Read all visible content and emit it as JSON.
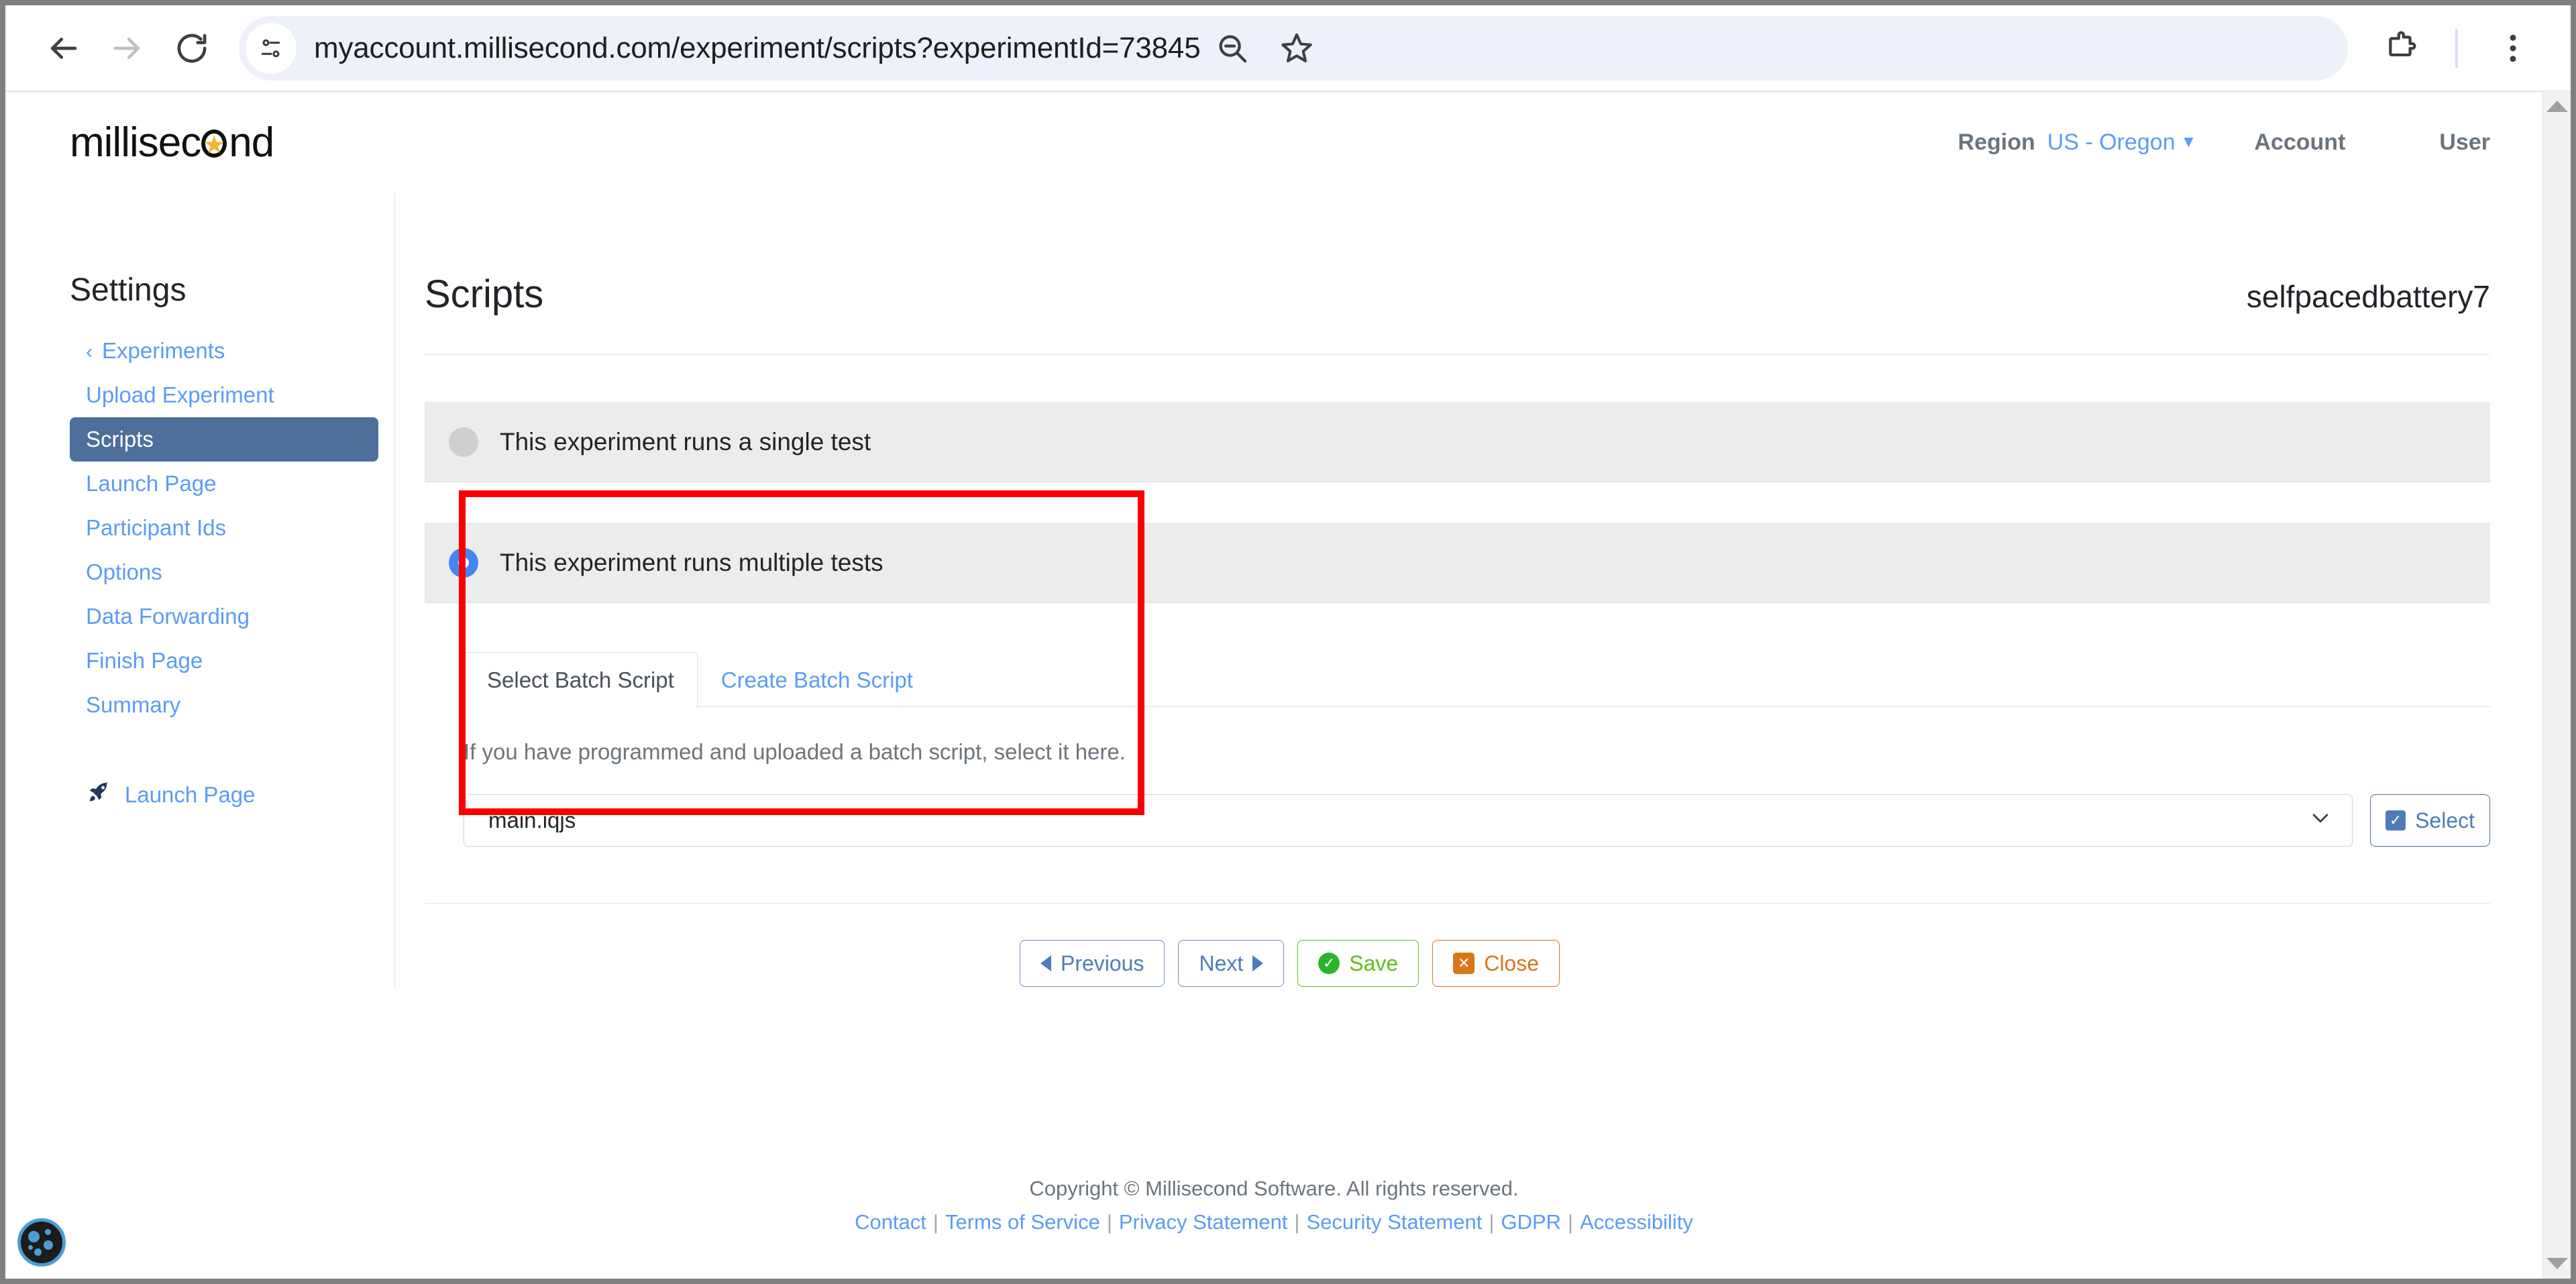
{
  "browser": {
    "url": "myaccount.millisecond.com/experiment/scripts?experimentId=73845",
    "back_label": "Back",
    "forward_label": "Forward",
    "reload_label": "Reload",
    "site_info_label": "View site information",
    "zoom_out_label": "Zoom out",
    "bookmark_label": "Bookmark this tab",
    "extensions_label": "Extensions",
    "menu_label": "Customize and control Chrome"
  },
  "header": {
    "logo_before": "millisec",
    "logo_after": "nd",
    "region_label": "Region",
    "region_value": "US - Oregon",
    "account_label": "Account",
    "user_label": "User"
  },
  "sidebar": {
    "title": "Settings",
    "items": [
      {
        "label": "Experiments",
        "active": false,
        "back": true
      },
      {
        "label": "Upload Experiment",
        "active": false,
        "back": false
      },
      {
        "label": "Scripts",
        "active": true,
        "back": false
      },
      {
        "label": "Launch Page",
        "active": false,
        "back": false
      },
      {
        "label": "Participant Ids",
        "active": false,
        "back": false
      },
      {
        "label": "Options",
        "active": false,
        "back": false
      },
      {
        "label": "Data Forwarding",
        "active": false,
        "back": false
      },
      {
        "label": "Finish Page",
        "active": false,
        "back": false
      },
      {
        "label": "Summary",
        "active": false,
        "back": false
      }
    ],
    "launch_link": "Launch Page"
  },
  "main": {
    "page_title": "Scripts",
    "experiment_name": "selfpacedbattery7",
    "options": [
      {
        "label": "This experiment runs a single test",
        "selected": false
      },
      {
        "label": "This experiment runs multiple tests",
        "selected": true
      }
    ],
    "tabs": [
      {
        "label": "Select Batch Script",
        "active": true
      },
      {
        "label": "Create Batch Script",
        "active": false
      }
    ],
    "hint": "If you have programmed and uploaded a batch script, select it here.",
    "script_value": "main.iqjs",
    "select_button": "Select",
    "actions": [
      {
        "label": "Previous",
        "style": "blue",
        "icon": "triangle-left"
      },
      {
        "label": "Next",
        "style": "blue",
        "icon": "triangle-right"
      },
      {
        "label": "Save",
        "style": "green",
        "icon": "check-circle"
      },
      {
        "label": "Close",
        "style": "orange",
        "icon": "x-square"
      }
    ]
  },
  "footer": {
    "copyright": "Copyright © Millisecond Software. All rights reserved.",
    "links": [
      "Contact",
      "Terms of Service",
      "Privacy Statement",
      "Security Statement",
      "GDPR",
      "Accessibility"
    ]
  },
  "accessibility_widget": {
    "label": "Accessibility options"
  },
  "colors": {
    "accent_blue": "#5b9bf8",
    "active_nav": "#4e6f9b",
    "radio_on": "#4285f4",
    "highlight_red": "#fa0000",
    "save_green": "#62bb1f",
    "close_orange": "#d9761a"
  }
}
